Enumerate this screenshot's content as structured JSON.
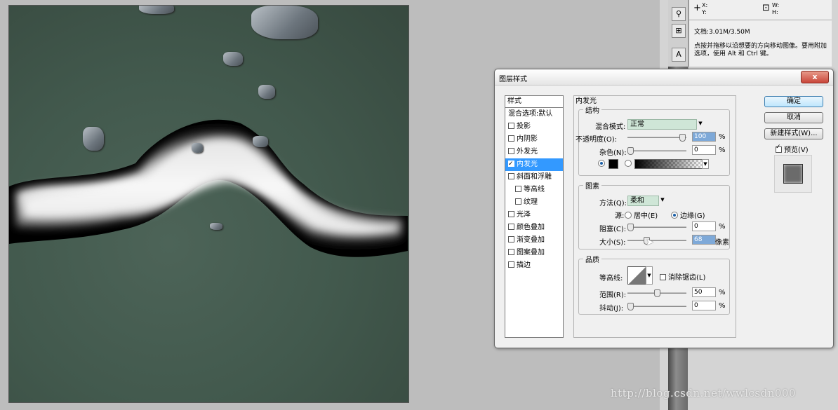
{
  "info_panel": {
    "x_label": "X:",
    "y_label": "Y:",
    "w_label": "W:",
    "h_label": "H:",
    "doc_size": "文档:3.01M/3.50M",
    "hint": "点按并拖移以沿想要的方向移动图像。要用附加选项，使用 Alt 和 Ctrl 键。"
  },
  "watermark": "http://blog.csdn.net/wwlcsdn000",
  "dialog": {
    "title": "图层样式",
    "close_label": "x",
    "style_list": {
      "header": "样式",
      "items": [
        {
          "label": "混合选项:默认",
          "checkbox": false,
          "checked": false,
          "selected": false,
          "sub": false
        },
        {
          "label": "投影",
          "checkbox": true,
          "checked": false,
          "selected": false,
          "sub": false
        },
        {
          "label": "内阴影",
          "checkbox": true,
          "checked": false,
          "selected": false,
          "sub": false
        },
        {
          "label": "外发光",
          "checkbox": true,
          "checked": false,
          "selected": false,
          "sub": false
        },
        {
          "label": "内发光",
          "checkbox": true,
          "checked": true,
          "selected": true,
          "sub": false
        },
        {
          "label": "斜面和浮雕",
          "checkbox": true,
          "checked": false,
          "selected": false,
          "sub": false
        },
        {
          "label": "等高线",
          "checkbox": true,
          "checked": false,
          "selected": false,
          "sub": true
        },
        {
          "label": "纹理",
          "checkbox": true,
          "checked": false,
          "selected": false,
          "sub": true
        },
        {
          "label": "光泽",
          "checkbox": true,
          "checked": false,
          "selected": false,
          "sub": false
        },
        {
          "label": "颜色叠加",
          "checkbox": true,
          "checked": false,
          "selected": false,
          "sub": false
        },
        {
          "label": "渐变叠加",
          "checkbox": true,
          "checked": false,
          "selected": false,
          "sub": false
        },
        {
          "label": "图案叠加",
          "checkbox": true,
          "checked": false,
          "selected": false,
          "sub": false
        },
        {
          "label": "描边",
          "checkbox": true,
          "checked": false,
          "selected": false,
          "sub": false
        }
      ]
    },
    "section_title": "内发光",
    "structure": {
      "legend": "结构",
      "blend_mode_label": "混合模式:",
      "blend_mode_value": "正常",
      "opacity_label": "不透明度(O):",
      "opacity_value": "100",
      "noise_label": "杂色(N):",
      "noise_value": "0",
      "percent": "%",
      "opacity_fraction": 0.97,
      "noise_fraction": 0.0
    },
    "elements": {
      "legend": "图素",
      "technique_label": "方法(Q):",
      "technique_value": "柔和",
      "source_label": "源:",
      "source_center": "居中(E)",
      "source_edge": "边缘(G)",
      "choke_label": "阻塞(C):",
      "choke_value": "0",
      "size_label": "大小(S):",
      "size_value": "68",
      "size_unit": "像素",
      "percent": "%",
      "choke_fraction": 0.0,
      "size_fraction": 0.3
    },
    "quality": {
      "legend": "品质",
      "contour_label": "等高线:",
      "antialias_label": "消除锯齿(L)",
      "range_label": "范围(R):",
      "range_value": "50",
      "jitter_label": "抖动(J):",
      "jitter_value": "0",
      "percent": "%",
      "range_fraction": 0.5,
      "jitter_fraction": 0.0
    },
    "buttons": {
      "ok": "确定",
      "cancel": "取消",
      "new_style": "新建样式(W)...",
      "preview": "预览(V)"
    },
    "colors": {
      "selection": "#3399ff",
      "blend_select_bg": "#cfe6d7",
      "glow_color": "#000000"
    }
  }
}
